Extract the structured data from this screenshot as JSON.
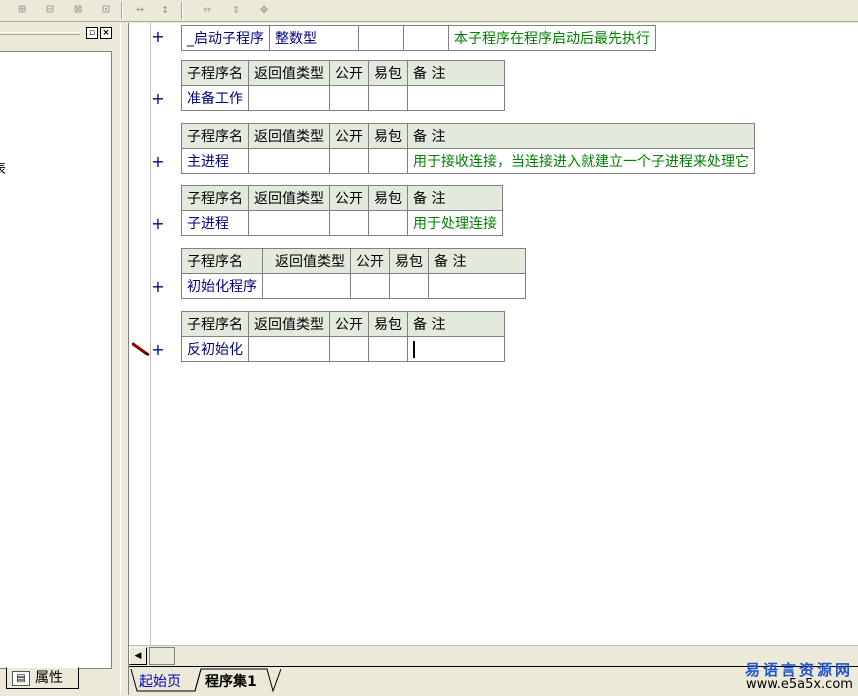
{
  "toolbar": {
    "icons": [
      "table-insert-icon",
      "table-row-icon",
      "table-column-icon",
      "table-merge-icon",
      "width-icon",
      "height-icon",
      "fit-width-icon",
      "fit-height-icon",
      "fit-both-icon"
    ]
  },
  "left_panel": {
    "tree_text": "表",
    "close_glyph": "×",
    "restore_glyph": "▫",
    "props_tab_label": "属性"
  },
  "editor": {
    "startup_table": {
      "name": "_启动子程序",
      "return_type": "整数型",
      "public": "",
      "easy": "",
      "note": "本子程序在程序启动后最先执行"
    },
    "header": {
      "name": "子程序名",
      "return_type": "返回值类型",
      "public": "公开",
      "easy": "易包",
      "note": "备 注"
    },
    "subs": [
      {
        "name": "准备工作",
        "return_type": "",
        "public": "",
        "easy": "",
        "note": ""
      },
      {
        "name": "主进程",
        "return_type": "",
        "public": "",
        "easy": "",
        "note": "用于接收连接，当连接进入就建立一个子进程来处理它"
      },
      {
        "name": "子进程",
        "return_type": "",
        "public": "",
        "easy": "",
        "note": "用于处理连接"
      },
      {
        "name": "初始化程序",
        "return_type": "",
        "public": "",
        "easy": "",
        "note": ""
      },
      {
        "name": "反初始化",
        "return_type": "",
        "public": "",
        "easy": "",
        "note": ""
      }
    ],
    "plus_glyph": "+"
  },
  "bottom": {
    "tab_start": "起始页",
    "tab_program": "程序集1",
    "scroll_left_glyph": "◀",
    "watermark_cn": "易语言资源网",
    "watermark_url": "www.e5a5x.com"
  },
  "colors": {
    "header_bg": "#e2eade",
    "note_green": "#008000",
    "name_navy": "#000080"
  }
}
